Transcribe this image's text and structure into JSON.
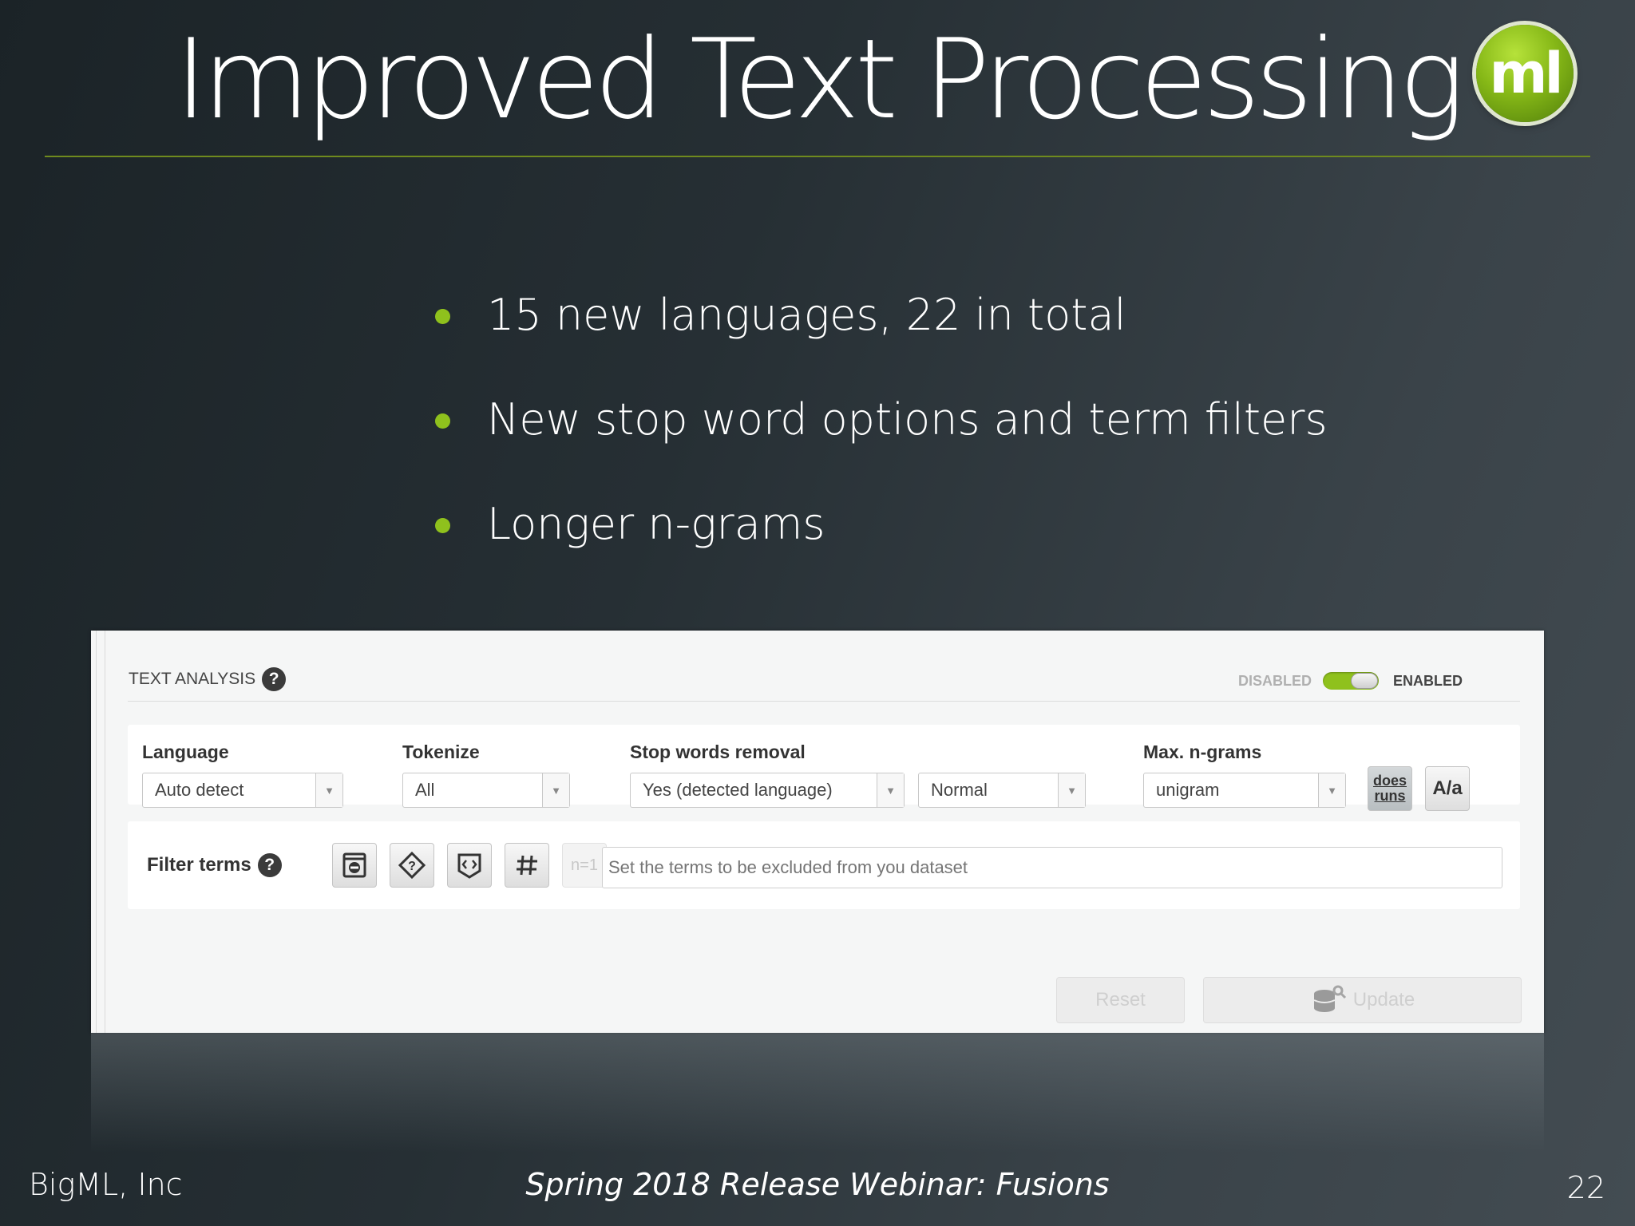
{
  "slide": {
    "title": "Improved Text Processing",
    "logo_text": "ml",
    "bullets": [
      "15 new languages, 22 in total",
      "New stop word options and term filters",
      "Longer n-grams"
    ]
  },
  "panel": {
    "section_title": "TEXT ANALYSIS",
    "help_icon": "?",
    "toggle": {
      "off_label": "DISABLED",
      "on_label": "ENABLED",
      "state": "enabled"
    },
    "language": {
      "label": "Language",
      "value": "Auto detect"
    },
    "tokenize": {
      "label": "Tokenize",
      "value": "All"
    },
    "stop_words": {
      "label": "Stop words removal",
      "value": "Yes (detected language)",
      "mode_value": "Normal"
    },
    "max_ngrams": {
      "label": "Max. n-grams",
      "value": "unigram"
    },
    "doesruns_top": "does",
    "doesruns_bottom": "runs",
    "case_button": "A/a",
    "filter": {
      "label": "Filter terms",
      "ngram_button": "n=1",
      "placeholder": "Set the terms to be excluded from you dataset",
      "icons": [
        "non-dictionary-icon",
        "diamond-question-icon",
        "code-icon",
        "hash-icon"
      ]
    },
    "reset_label": "Reset",
    "update_label": "Update"
  },
  "footer": {
    "left": "BigML, Inc",
    "center": "Spring 2018 Release Webinar: Fusions",
    "page_number": "22"
  },
  "colors": {
    "accent": "#8fc11d",
    "rule": "#6f8a1e"
  }
}
